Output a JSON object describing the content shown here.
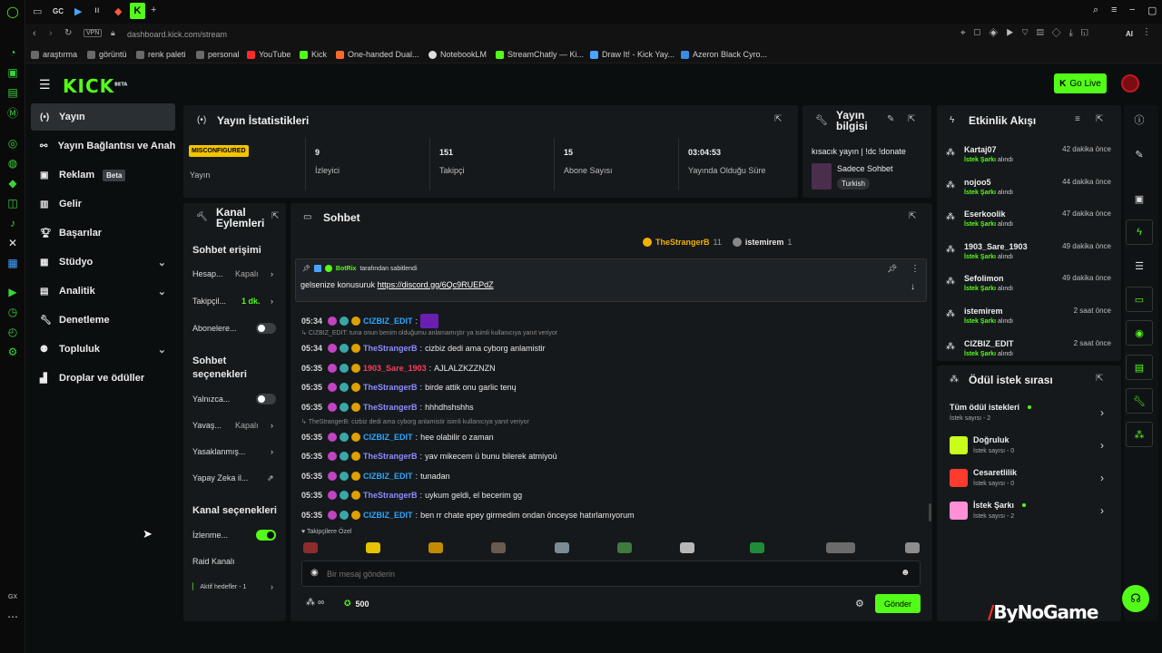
{
  "browser": {
    "tabs": [
      "GC"
    ],
    "url_host": "dashboard.kick.com",
    "url_path": "/stream",
    "vpn": "VPN",
    "ai": "AI",
    "bookmarks": [
      "araştırma",
      "görüntü",
      "renk paleti",
      "personal",
      "YouTube",
      "Kick",
      "One-handed Dual...",
      "NotebookLM",
      "StreamChatly — Ki...",
      "Draw It! - Kick Yay...",
      "Azeron Black Cyro..."
    ],
    "gx": "GX"
  },
  "header": {
    "logo": "KICK",
    "logo_sup": "BETA",
    "go_live": "Go Live"
  },
  "sidebar": {
    "items": [
      {
        "label": "Yayın",
        "icon": "broadcast-icon",
        "active": true
      },
      {
        "label": "Yayın Bağlantısı ve Anahtarı",
        "icon": "link-icon"
      },
      {
        "label": "Reklam",
        "icon": "ad-icon",
        "badge": "Beta"
      },
      {
        "label": "Gelir",
        "icon": "chart-icon"
      },
      {
        "label": "Başarılar",
        "icon": "trophy-icon"
      },
      {
        "label": "Stüdyo",
        "icon": "studio-icon",
        "chevron": true
      },
      {
        "label": "Analitik",
        "icon": "analytics-icon",
        "chevron": true
      },
      {
        "label": "Denetleme",
        "icon": "wrench-icon"
      },
      {
        "label": "Topluluk",
        "icon": "community-icon",
        "chevron": true
      },
      {
        "label": "Droplar ve ödüller",
        "icon": "drops-icon"
      }
    ]
  },
  "stats": {
    "title": "Yayın İstatistikleri",
    "badge": "MISCONFIGURED",
    "status_label": "Yayın",
    "items": [
      {
        "value": "9",
        "label": "İzleyici"
      },
      {
        "value": "151",
        "label": "Takipçi"
      },
      {
        "value": "15",
        "label": "Abone Sayısı"
      },
      {
        "value": "03:04:53",
        "label": "Yayında Olduğu Süre"
      }
    ]
  },
  "info": {
    "title_l1": "Yayın",
    "title_l2": "bilgisi",
    "stream_title": "kısacık yayın | !dc !donate",
    "category": "Sadece Sohbet",
    "language": "Turkish"
  },
  "actions": {
    "title_l1": "Kanal",
    "title_l2": "Eylemleri",
    "chat_access": "Sohbet erişimi",
    "rows1": [
      {
        "label": "Hesap...",
        "value": "Kapalı"
      },
      {
        "label": "Takipçil...",
        "value": "1 dk."
      },
      {
        "label": "Abonelere..."
      }
    ],
    "chat_opts_l1": "Sohbet",
    "chat_opts_l2": "seçenekleri",
    "rows2": [
      {
        "label": "Yalnızca..."
      },
      {
        "label": "Yavaş...",
        "value": "Kapalı"
      },
      {
        "label": "Yasaklanmış..."
      },
      {
        "label": "Yapay Zeka il..."
      }
    ],
    "channel_opts": "Kanal seçenekleri",
    "rows3": [
      {
        "label": "İzlenme..."
      },
      {
        "label": "Raid Kanalı"
      }
    ],
    "active_goals": "Aktif hedefler - 1"
  },
  "chat": {
    "title": "Sohbet",
    "top_user_1": "TheStrangerB",
    "top_user_1_count": "11",
    "top_user_2": "istemirem",
    "top_user_2_count": "1",
    "pinned_by": "BotRix",
    "pinned_suffix": "tarafından sabitlendi",
    "pinned_text": "gelsenize konusuruk",
    "pinned_link": "https://discord.gg/6Qc9RUEPdZ",
    "messages": [
      {
        "time": "05:34",
        "user": "CIZBIZ_EDIT",
        "color": "#2ea7ff",
        "text": ""
      },
      {
        "reply": "CIZBIZ_EDIT: tuna onun benim olduğumu anlamamıştır ya isimli kullanıcıya yanıt veriyor"
      },
      {
        "time": "05:34",
        "user": "TheStrangerB",
        "color": "#8c8cff",
        "text": "cizbiz dedi ama cyborg anlamistir"
      },
      {
        "time": "05:35",
        "user": "1903_Sare_1903",
        "color": "#ff3b5c",
        "text": "AJLALZKZZNZN"
      },
      {
        "time": "05:35",
        "user": "TheStrangerB",
        "color": "#8c8cff",
        "text": "birde attik onu garlic tenų"
      },
      {
        "time": "05:35",
        "user": "TheStrangerB",
        "color": "#8c8cff",
        "text": "hhhdhshshhs"
      },
      {
        "reply": "TheStrangerB: cizbiz dedi ama cyborg anlamistir isimli kullanıcıya yanıt veriyor"
      },
      {
        "time": "05:35",
        "user": "CIZBIZ_EDIT",
        "color": "#2ea7ff",
        "text": "hee olabilir o zaman"
      },
      {
        "time": "05:35",
        "user": "TheStrangerB",
        "color": "#8c8cff",
        "text": "yav mikecem ü bunu bilerek atmiyoù"
      },
      {
        "time": "05:35",
        "user": "CIZBIZ_EDIT",
        "color": "#2ea7ff",
        "text": "tunadan"
      },
      {
        "time": "05:35",
        "user": "TheStrangerB",
        "color": "#8c8cff",
        "text": "uykum geldi, el becerim gg"
      },
      {
        "time": "05:35",
        "user": "CIZBIZ_EDIT",
        "color": "#2ea7ff",
        "text": "ben rr chate epey girmedim ondan önceyse hatırlamıyorum"
      }
    ],
    "followers_only": "Takipçilere Özel",
    "placeholder": "Bir mesaj gönderin",
    "points_prefix": "∞",
    "points": "500",
    "send": "Gönder"
  },
  "events": {
    "title": "Etkinlik Akışı",
    "items": [
      {
        "user": "Kartaj07",
        "time": "42 dakika önce",
        "reward": "İstek Şarkı",
        "suffix": "alındı"
      },
      {
        "user": "nojoo5",
        "time": "44 dakika önce",
        "reward": "İstek Şarkı",
        "suffix": "alındı"
      },
      {
        "user": "Eserkoolik",
        "time": "47 dakika önce",
        "reward": "İstek Şarkı",
        "suffix": "alındı"
      },
      {
        "user": "1903_Sare_1903",
        "time": "49 dakika önce",
        "reward": "İstek Şarkı",
        "suffix": "alındı"
      },
      {
        "user": "Sefolimon",
        "time": "49 dakika önce",
        "reward": "İstek Şarkı",
        "suffix": "alındı"
      },
      {
        "user": "istemirem",
        "time": "2 saat önce",
        "reward": "İstek Şarkı",
        "suffix": "alındı"
      },
      {
        "user": "CIZBIZ_EDIT",
        "time": "2 saat önce",
        "reward": "İstek Şarkı",
        "suffix": "alındı"
      }
    ]
  },
  "rewards": {
    "title": "Ödül istek sırası",
    "items": [
      {
        "name": "Tüm ödül istekleri",
        "count": "İstek sayısı - 2",
        "color": ""
      },
      {
        "name": "Doğruluk",
        "count": "İstek sayısı - 0",
        "color": "#c8ff1a"
      },
      {
        "name": "Cesaretlilik",
        "count": "İstek sayısı - 0",
        "color": "#ff3b2f"
      },
      {
        "name": "İstek Şarkı",
        "count": "İstek sayısı - 2",
        "color": "#ff8fd6"
      }
    ]
  },
  "watermark": "ByNoGame"
}
